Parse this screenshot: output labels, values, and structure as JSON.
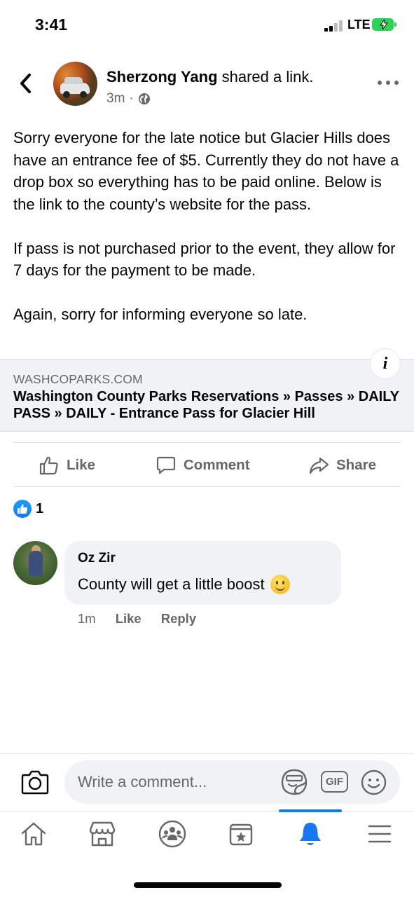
{
  "status_bar": {
    "time": "3:41",
    "network": "LTE"
  },
  "post": {
    "author": "Sherzong Yang",
    "action_text": " shared a link.",
    "time_ago": "3m",
    "separator": "·",
    "paragraphs": [
      "Sorry everyone for the late notice but Glacier Hills does have an entrance fee of $5. Currently they do not have a drop box so everything has to be paid online. Below is the link to the county’s website for the pass.",
      "If pass is not purchased prior to the event, they allow for 7 days for the payment to be made.",
      "Again, sorry for informing everyone so late."
    ]
  },
  "link_card": {
    "domain": "WASHCOPARKS.COM",
    "title": "Washington County Parks Reservations » Passes » DAILY PASS » DAILY - Entrance Pass for Glacier Hill",
    "info_icon": "i"
  },
  "actions": {
    "like": "Like",
    "comment": "Comment",
    "share": "Share"
  },
  "reactions": {
    "count": "1"
  },
  "comment": {
    "author": "Oz Zir",
    "text": "County will get a little boost",
    "time_ago": "1m",
    "like": "Like",
    "reply": "Reply"
  },
  "composer": {
    "placeholder": "Write a comment...",
    "gif_label": "GIF"
  },
  "colors": {
    "accent": "#1877f2",
    "secondary_text": "#65676b",
    "bubble": "#f0f2f5",
    "battery": "#30d158"
  },
  "icons": [
    "back-arrow",
    "more-dots",
    "globe",
    "info",
    "thumbs-up",
    "comment",
    "share",
    "camera",
    "sticker",
    "gif",
    "emoji",
    "home",
    "marketplace",
    "groups",
    "pages",
    "bell",
    "menu"
  ]
}
